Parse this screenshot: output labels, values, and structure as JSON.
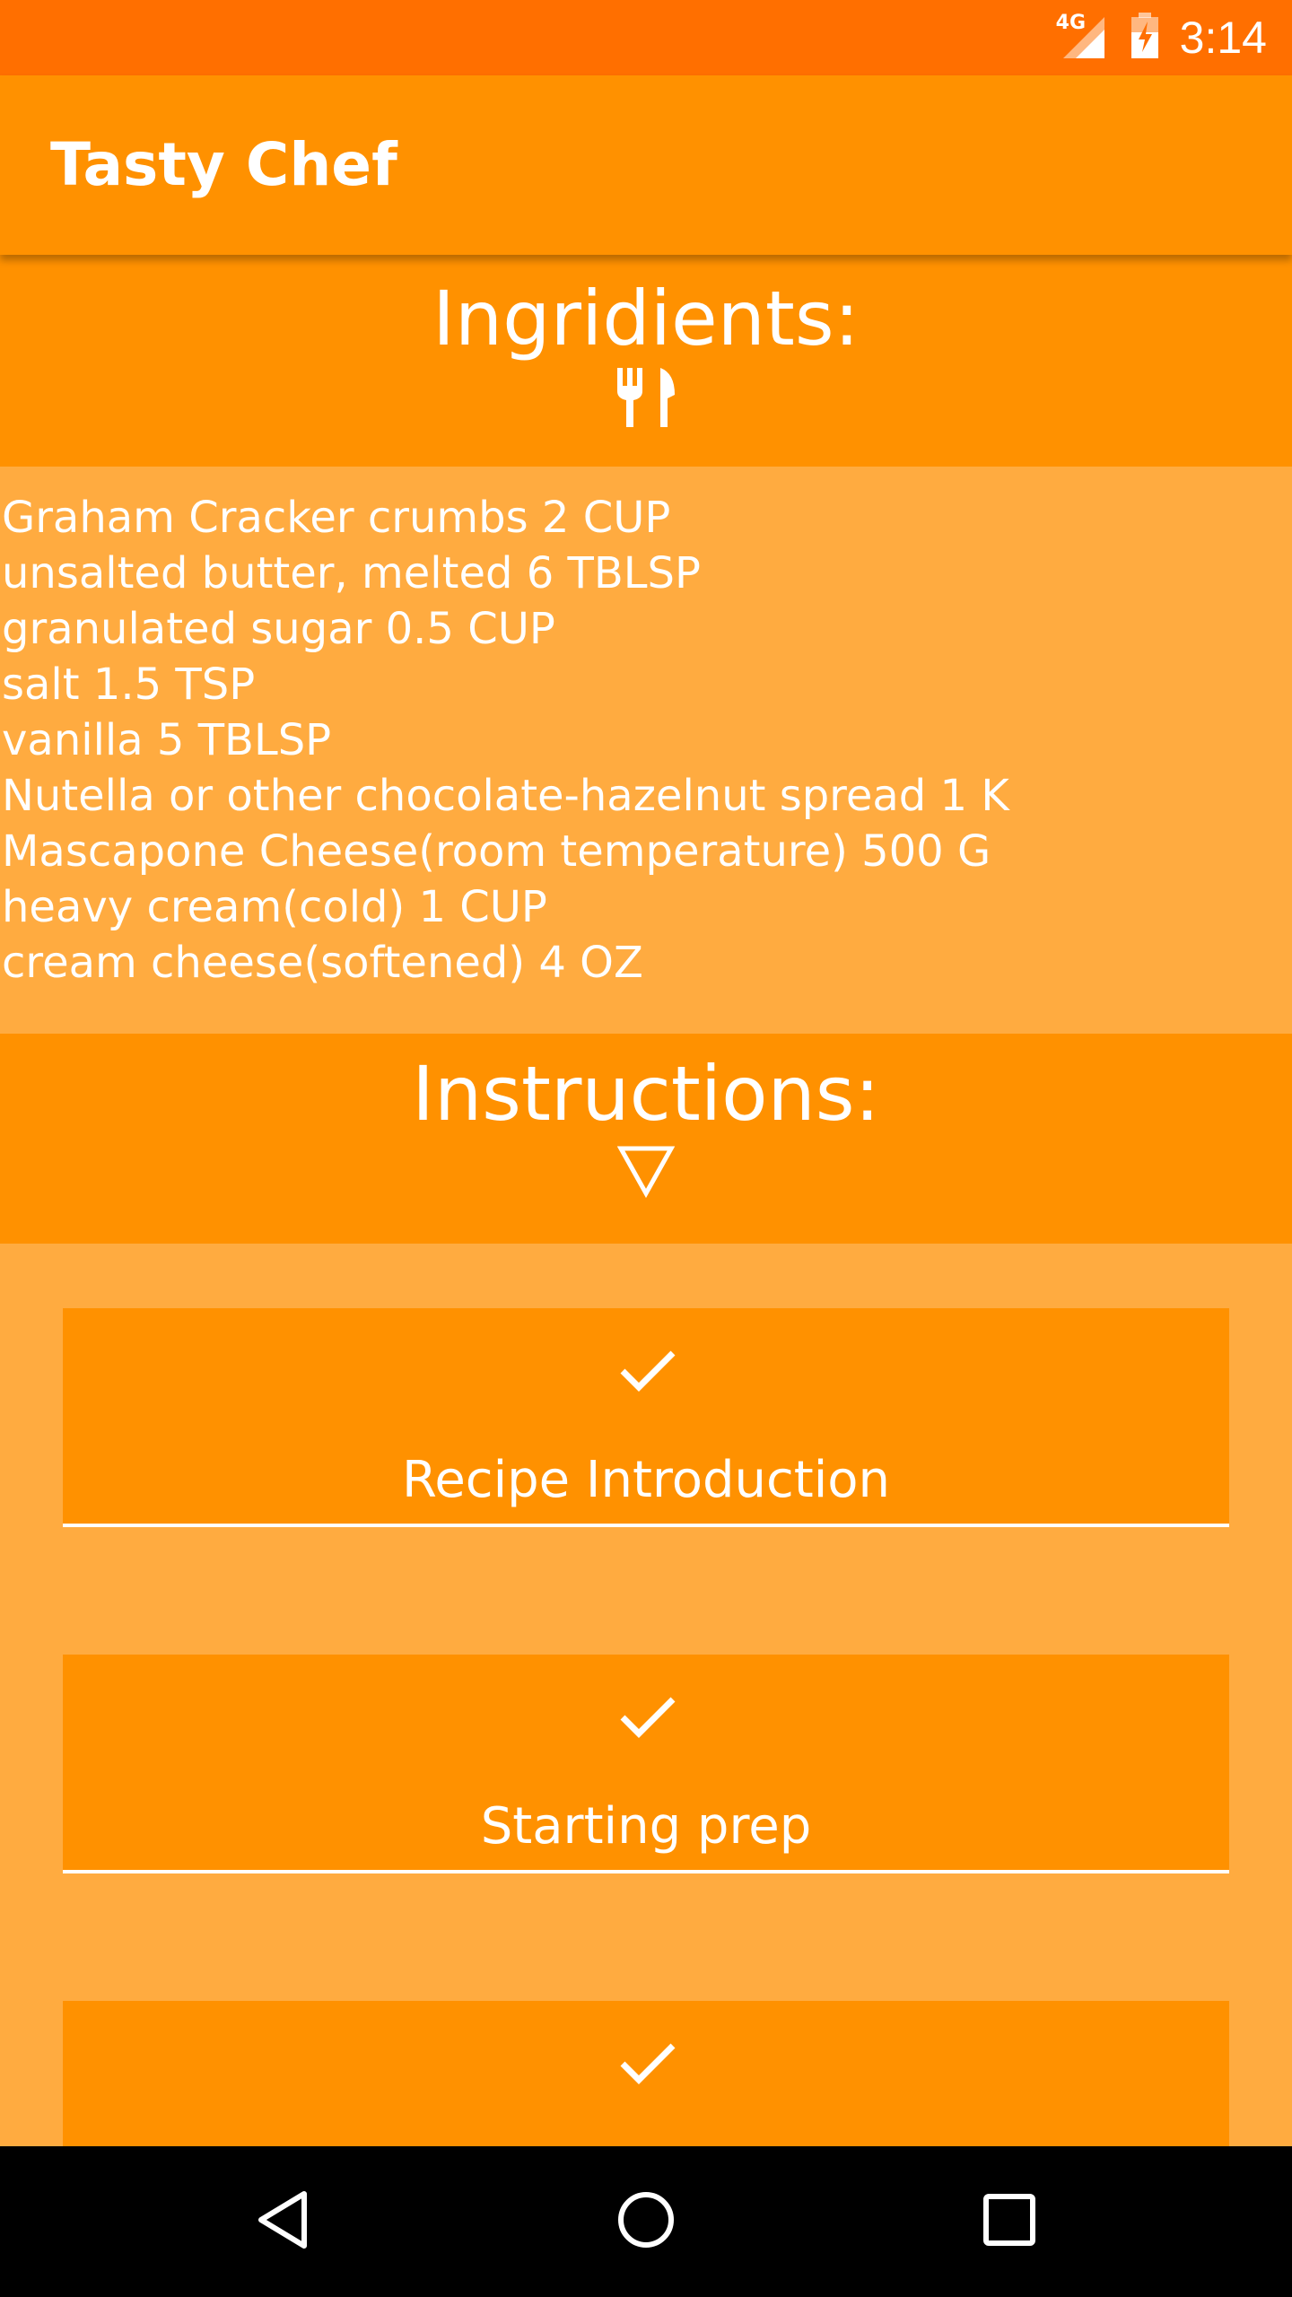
{
  "status_bar": {
    "network": "4G",
    "time": "3:14",
    "icons": [
      "signal-icon",
      "battery-charging-icon"
    ]
  },
  "app_bar": {
    "title": "Tasty Chef"
  },
  "ingredients": {
    "title": "Ingridients:",
    "icon": "utensils-icon",
    "items": [
      "Graham Cracker crumbs 2 CUP",
      "unsalted butter, melted 6 TBLSP",
      "granulated sugar 0.5 CUP",
      "salt 1.5 TSP",
      "vanilla 5 TBLSP",
      "Nutella or other chocolate-hazelnut spread 1 K",
      "Mascapone Cheese(room temperature) 500 G",
      "heavy cream(cold) 1 CUP",
      "cream cheese(softened) 4 OZ"
    ]
  },
  "instructions": {
    "title": "Instructions:",
    "icon": "triangle-down-icon",
    "steps": [
      {
        "label": "Recipe Introduction",
        "icon": "check-icon"
      },
      {
        "label": "Starting prep",
        "icon": "check-icon"
      },
      {
        "label": "",
        "icon": "check-icon"
      }
    ]
  },
  "nav_bar": {
    "buttons": [
      "back-icon",
      "home-icon",
      "recents-icon"
    ]
  },
  "colors": {
    "status_bar": "#FF6F00",
    "primary": "#FF9100",
    "background": "#FFAB40",
    "text": "#FFFFFF"
  }
}
